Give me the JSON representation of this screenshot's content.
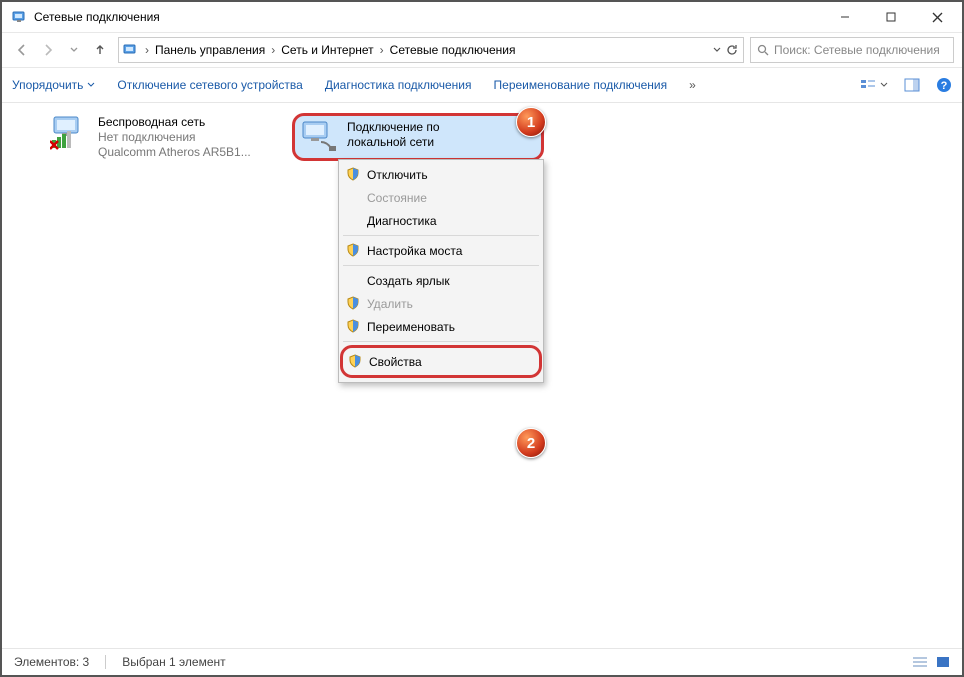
{
  "window": {
    "title": "Сетевые подключения"
  },
  "breadcrumb": {
    "p1": "Панель управления",
    "p2": "Сеть и Интернет",
    "p3": "Сетевые подключения"
  },
  "search": {
    "placeholder": "Поиск: Сетевые подключения"
  },
  "cmdbar": {
    "organize": "Упорядочить",
    "disable": "Отключение сетевого устройства",
    "diagnose": "Диагностика подключения",
    "rename": "Переименование подключения"
  },
  "items": {
    "wifi": {
      "name": "Беспроводная сеть",
      "status": "Нет подключения",
      "device": "Qualcomm Atheros AR5B1..."
    },
    "lan": {
      "name": "Подключение по",
      "name2": "локальной сети"
    }
  },
  "menu": {
    "disable": "Отключить",
    "status": "Состояние",
    "diag": "Диагностика",
    "bridge": "Настройка моста",
    "shortcut": "Создать ярлык",
    "delete": "Удалить",
    "rename": "Переименовать",
    "props": "Свойства"
  },
  "status": {
    "count": "Элементов: 3",
    "selected": "Выбран 1 элемент"
  },
  "badges": {
    "b1": "1",
    "b2": "2"
  }
}
